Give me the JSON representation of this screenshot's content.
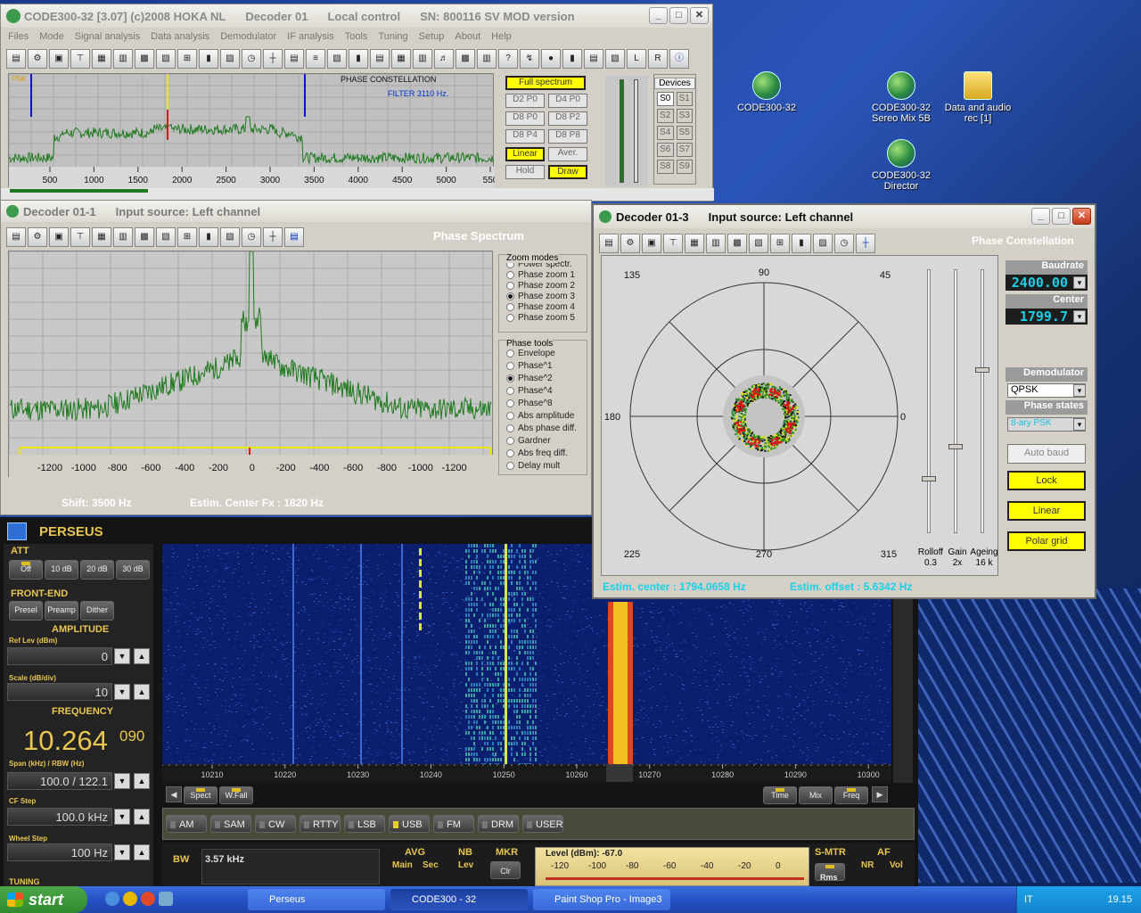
{
  "desktop": {
    "icons": [
      {
        "label": "CODE300-32"
      },
      {
        "label": "CODE300-32 Sereo Mix 5B"
      },
      {
        "label": "Data and audio rec [1]"
      },
      {
        "label": "CODE300-32 Director"
      }
    ]
  },
  "main_window": {
    "title": "CODE300-32 [3.07] (c)2008 HOKA NL",
    "decoder": "Decoder 01",
    "control": "Local control",
    "sn": "SN: 800116 SV MOD version",
    "menu": [
      "Files",
      "Mode",
      "Signal analysis",
      "Data analysis",
      "Demodulator",
      "IF analysis",
      "Tools",
      "Tuning",
      "Setup",
      "About",
      "Help"
    ],
    "spectrum": {
      "corner_label": "PSK",
      "mode_label": "PHASE CONSTELLATION",
      "filter_label": "FILTER 3110 Hz.",
      "x_ticks": [
        "500",
        "1000",
        "1500",
        "2000",
        "2500",
        "3000",
        "3500",
        "4000",
        "4500",
        "5000",
        "550"
      ]
    },
    "buttons": [
      "Full spectrum",
      "D2 P0",
      "D4 P0",
      "D8 P0",
      "D8 P2",
      "D8 P4",
      "D8 P8",
      "Linear",
      "Aver.",
      "Hold",
      "Draw"
    ],
    "devices": {
      "label": "Devices",
      "items": [
        "S0",
        "S1",
        "S2",
        "S3",
        "S4",
        "S5",
        "S6",
        "S7",
        "S8",
        "S9"
      ]
    }
  },
  "decoder1": {
    "title": "Decoder 01-1",
    "source": "Input source: Left channel",
    "panel_title": "Phase Spectrum",
    "x_ticks": [
      "-1200",
      "-1000",
      "-800",
      "-600",
      "-400",
      "-200",
      "0",
      "-200",
      "-400",
      "-600",
      "-800",
      "-1000",
      "-1200"
    ],
    "zoom_modes": {
      "label": "Zoom modes",
      "items": [
        "Power spectr.",
        "Phase zoom 1",
        "Phase zoom 2",
        "Phase zoom 3",
        "Phase zoom 4",
        "Phase zoom 5"
      ],
      "selected": 3
    },
    "phase_tools": {
      "label": "Phase tools",
      "items": [
        "Envelope",
        "Phase^1",
        "Phase^2",
        "Phase^4",
        "Phase^8",
        "Abs amplitude",
        "Abs phase diff.",
        "Gardner",
        "Abs freq diff.",
        "Delay mult"
      ],
      "selected": 2
    },
    "shift": "Shift: 3500 Hz",
    "center": "Estim. Center Fx : 1820 Hz"
  },
  "decoder3": {
    "title": "Decoder 01-3",
    "source": "Input source: Left channel",
    "panel_title": "Phase Constellation",
    "angles": {
      "a90": "90",
      "a45": "45",
      "a135": "135",
      "a180": "180",
      "a0": "0",
      "a225": "225",
      "a270": "270",
      "a315": "315"
    },
    "baudrate_label": "Baudrate",
    "baudrate_value": "2400.00",
    "center_label": "Center",
    "center_value": "1799.7",
    "demod_label": "Demodulator",
    "demod_value": "QPSK",
    "phase_states_label": "Phase states",
    "phase_states_value": "8-ary PSK",
    "buttons": [
      "Auto baud",
      "Lock",
      "Linear",
      "Polar grid"
    ],
    "sliders": [
      {
        "label": "Rolloff",
        "value": "0.3"
      },
      {
        "label": "Gain",
        "value": "2x"
      },
      {
        "label": "Ageing",
        "value": "16 k"
      }
    ],
    "estim_center": "Estim. center :  1794.0658 Hz",
    "estim_offset": "Estim. offset : 5.6342 Hz"
  },
  "perseus": {
    "title": "PERSEUS",
    "att_label": "ATT",
    "att_buttons": [
      "Off",
      "10 dB",
      "20 dB",
      "30 dB"
    ],
    "frontend_label": "FRONT-END",
    "frontend_buttons": [
      "Presel",
      "Preamp",
      "Dither"
    ],
    "amplitude_label": "AMPLITUDE",
    "ref_lev_label": "Ref Lev (dBm)",
    "ref_lev_value": "0",
    "scale_label": "Scale (dB/div)",
    "scale_value": "10",
    "frequency_label": "FREQUENCY",
    "freq_main": "10.264",
    "freq_small": "090",
    "span_label": "Span (kHz) / RBW (Hz)",
    "span_value": "100.0 / 122.1",
    "cf_step_label": "CF Step",
    "cf_step_value": "100.0 kHz",
    "wheel_step_label": "Wheel Step",
    "wheel_step_value": "100 Hz",
    "tuning_label": "TUNING",
    "freq_ticks": [
      "10210",
      "10220",
      "10230",
      "10240",
      "10250",
      "10260",
      "10270",
      "10280",
      "10290",
      "10300"
    ],
    "view_buttons": [
      "Spect",
      "W.Fall"
    ],
    "right_buttons": [
      "Time",
      "Mix",
      "Freq"
    ],
    "modes": [
      "AM",
      "SAM",
      "CW",
      "RTTY",
      "LSB",
      "USB",
      "FM",
      "DRM",
      "USER"
    ],
    "bw_label": "BW",
    "bw_value": "3.57 kHz",
    "avg_label": "AVG",
    "avg_main": "Main",
    "avg_sec": "Sec",
    "nb_label": "NB",
    "nb_lev": "Lev",
    "mkr_label": "MKR",
    "mkr_clr": "Clr",
    "level_label": "Level (dBm): -67.0",
    "meter_ticks": [
      "-120",
      "-100",
      "-80",
      "-60",
      "-40",
      "-20",
      "0"
    ],
    "smtr_label": "S-MTR",
    "smtr_rms": "Rms",
    "af_label": "AF",
    "af_nr": "NR",
    "af_vol": "Vol"
  },
  "taskbar": {
    "start": "start",
    "items": [
      "Perseus",
      "CODE300 - 32",
      "Paint Shop Pro - Image3"
    ],
    "lang": "IT",
    "clock": "19.15"
  },
  "colors": {
    "trace": "#1f7a1f",
    "marker": "#e8e800",
    "accent": "#18d0e8"
  }
}
